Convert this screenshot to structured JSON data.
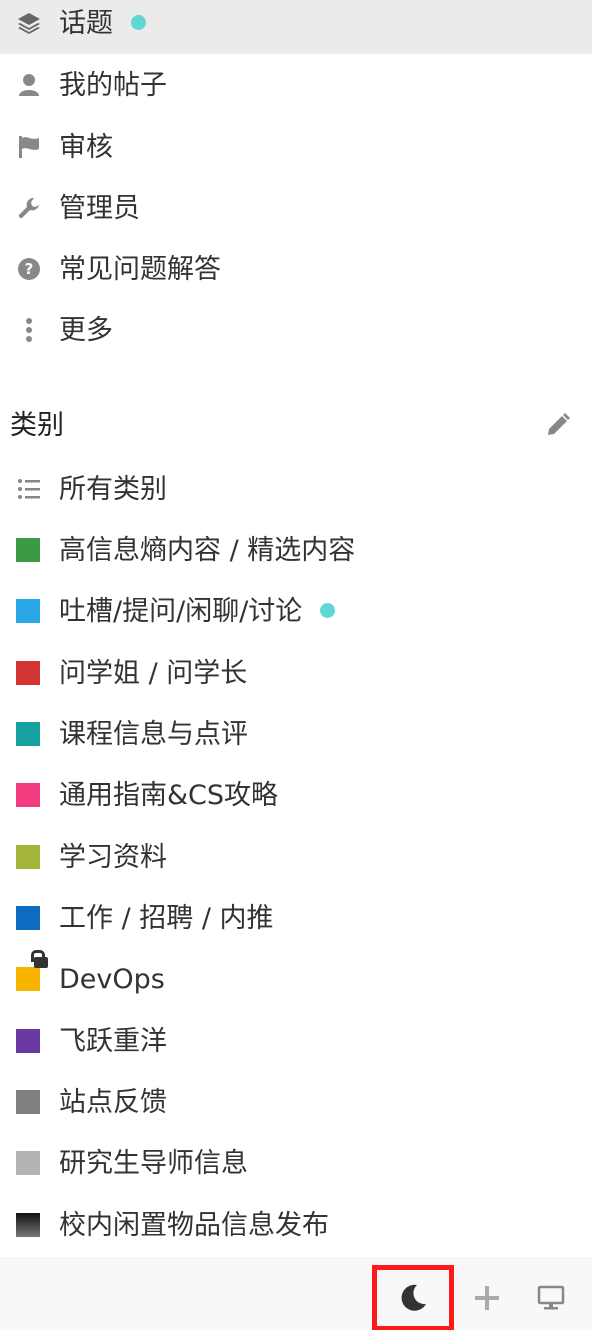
{
  "nav": {
    "items": [
      {
        "label": "话题",
        "icon": "layers-icon"
      },
      {
        "label": "我的帖子",
        "icon": "user-icon"
      },
      {
        "label": "审核",
        "icon": "flag-icon"
      },
      {
        "label": "管理员",
        "icon": "wrench-icon"
      },
      {
        "label": "常见问题解答",
        "icon": "question-circle-icon"
      },
      {
        "label": "更多",
        "icon": "vertical-ellipsis-icon"
      }
    ]
  },
  "categories": {
    "title": "类别",
    "all_label": "所有类别",
    "items": [
      {
        "label": "高信息熵内容 / 精选内容",
        "color": "#3a9a45"
      },
      {
        "label": "吐槽/提问/闲聊/讨论",
        "color": "#2aa7e6"
      },
      {
        "label": "问学姐 / 问学长",
        "color": "#d43434"
      },
      {
        "label": "课程信息与点评",
        "color": "#16a19e"
      },
      {
        "label": "通用指南&CS攻略",
        "color": "#f03c7e"
      },
      {
        "label": "学习资料",
        "color": "#a5b53a"
      },
      {
        "label": "工作 / 招聘 / 内推",
        "color": "#0e6bc0"
      },
      {
        "label": "DevOps",
        "color": "#f7b500"
      },
      {
        "label": "飞跃重洋",
        "color": "#6a3aa2"
      },
      {
        "label": "站点反馈",
        "color": "#808080"
      },
      {
        "label": "研究生导师信息",
        "color": "#b4b4b4"
      },
      {
        "label": "校内闲置物品信息发布",
        "color": "#2a2a2a"
      }
    ]
  },
  "footer": {
    "icons": [
      "moon-icon",
      "plus-icon",
      "desktop-icon"
    ]
  }
}
